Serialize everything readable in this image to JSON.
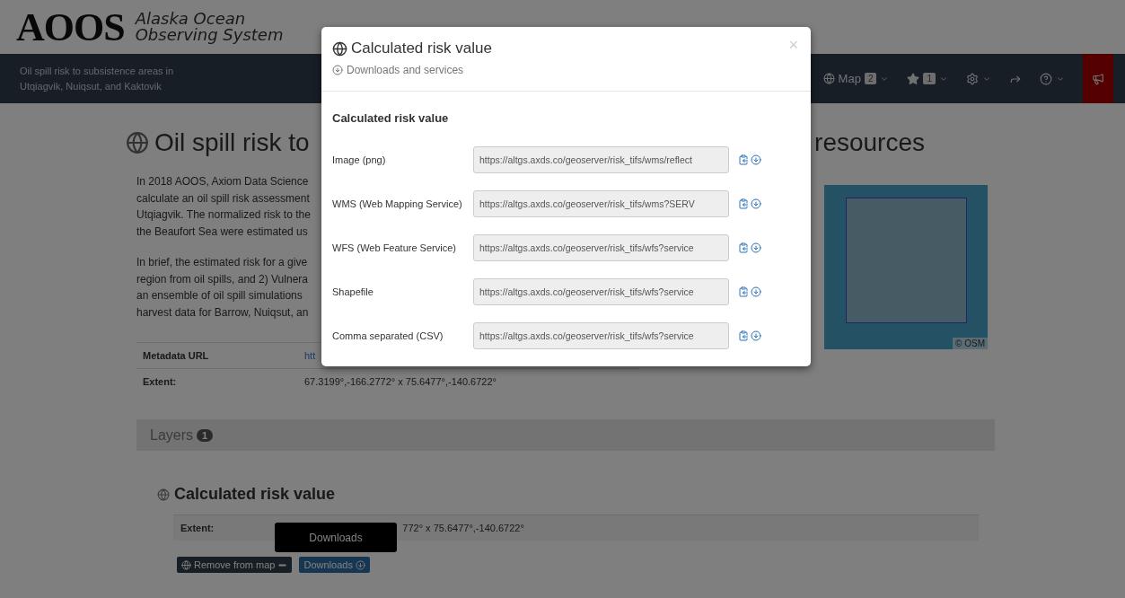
{
  "header": {
    "logo_text": "AOOS",
    "org_name": [
      "Alaska Ocean",
      "Observing System"
    ]
  },
  "navbar": {
    "subtitle": [
      "Oil spill risk to subsistence areas in",
      "Utqiagvik, Nuiqsut, and Kaktovik"
    ],
    "items": [
      {
        "kind": "map",
        "label": "Map",
        "badge": "2"
      },
      {
        "kind": "favorites",
        "badge": "1"
      },
      {
        "kind": "settings"
      },
      {
        "kind": "share"
      },
      {
        "kind": "help"
      },
      {
        "kind": "announcements"
      }
    ]
  },
  "page": {
    "title_start": "Oil spill risk to",
    "title_end": "resources",
    "paragraphs": [
      [
        "In 2018 AOOS, Axiom Data Science",
        "calculate an oil spill risk assessment",
        "Utqiagvik. The normalized risk to the",
        "the Beaufort Sea were estimated us"
      ],
      [
        "In brief, the estimated risk for a give",
        "region from oil spills, and 2) Vulnera",
        "an ensemble of oil spill simulations",
        "harvest data for Barrow, Nuiqsut, an"
      ]
    ],
    "metadata": [
      {
        "kind": "link",
        "label": "Metadata URL",
        "value": "htt"
      },
      {
        "kind": "text",
        "label": "Extent:",
        "value": "67.3199°,-166.2772° x 75.6477°,-140.6722°"
      }
    ],
    "map": {
      "attribution": "© OSM"
    },
    "layers": {
      "label": "Layers",
      "count": "1"
    },
    "layer": {
      "title": "Calculated risk value",
      "extent_label": "Extent:",
      "extent_value": "772° x 75.6477°,-140.6722°",
      "buttons": [
        {
          "kind": "remove",
          "label": "Remove from map"
        },
        {
          "kind": "downloads",
          "label": "Downloads"
        }
      ]
    },
    "tooltip": "Downloads"
  },
  "modal": {
    "title": "Calculated risk value",
    "subtitle": "Downloads and services",
    "close": "×",
    "section": "Calculated risk value",
    "rows": [
      {
        "label": "Image (png)",
        "url": "https://altgs.axds.co/geoserver/risk_tifs/wms/reflect"
      },
      {
        "label": "WMS (Web Mapping Service)",
        "url": "https://altgs.axds.co/geoserver/risk_tifs/wms?SERV"
      },
      {
        "label": "WFS (Web Feature Service)",
        "url": "https://altgs.axds.co/geoserver/risk_tifs/wfs?service"
      },
      {
        "label": "Shapefile",
        "url": "https://altgs.axds.co/geoserver/risk_tifs/wfs?service"
      },
      {
        "label": "Comma separated (CSV)",
        "url": "https://altgs.axds.co/geoserver/risk_tifs/wfs?service"
      }
    ]
  }
}
